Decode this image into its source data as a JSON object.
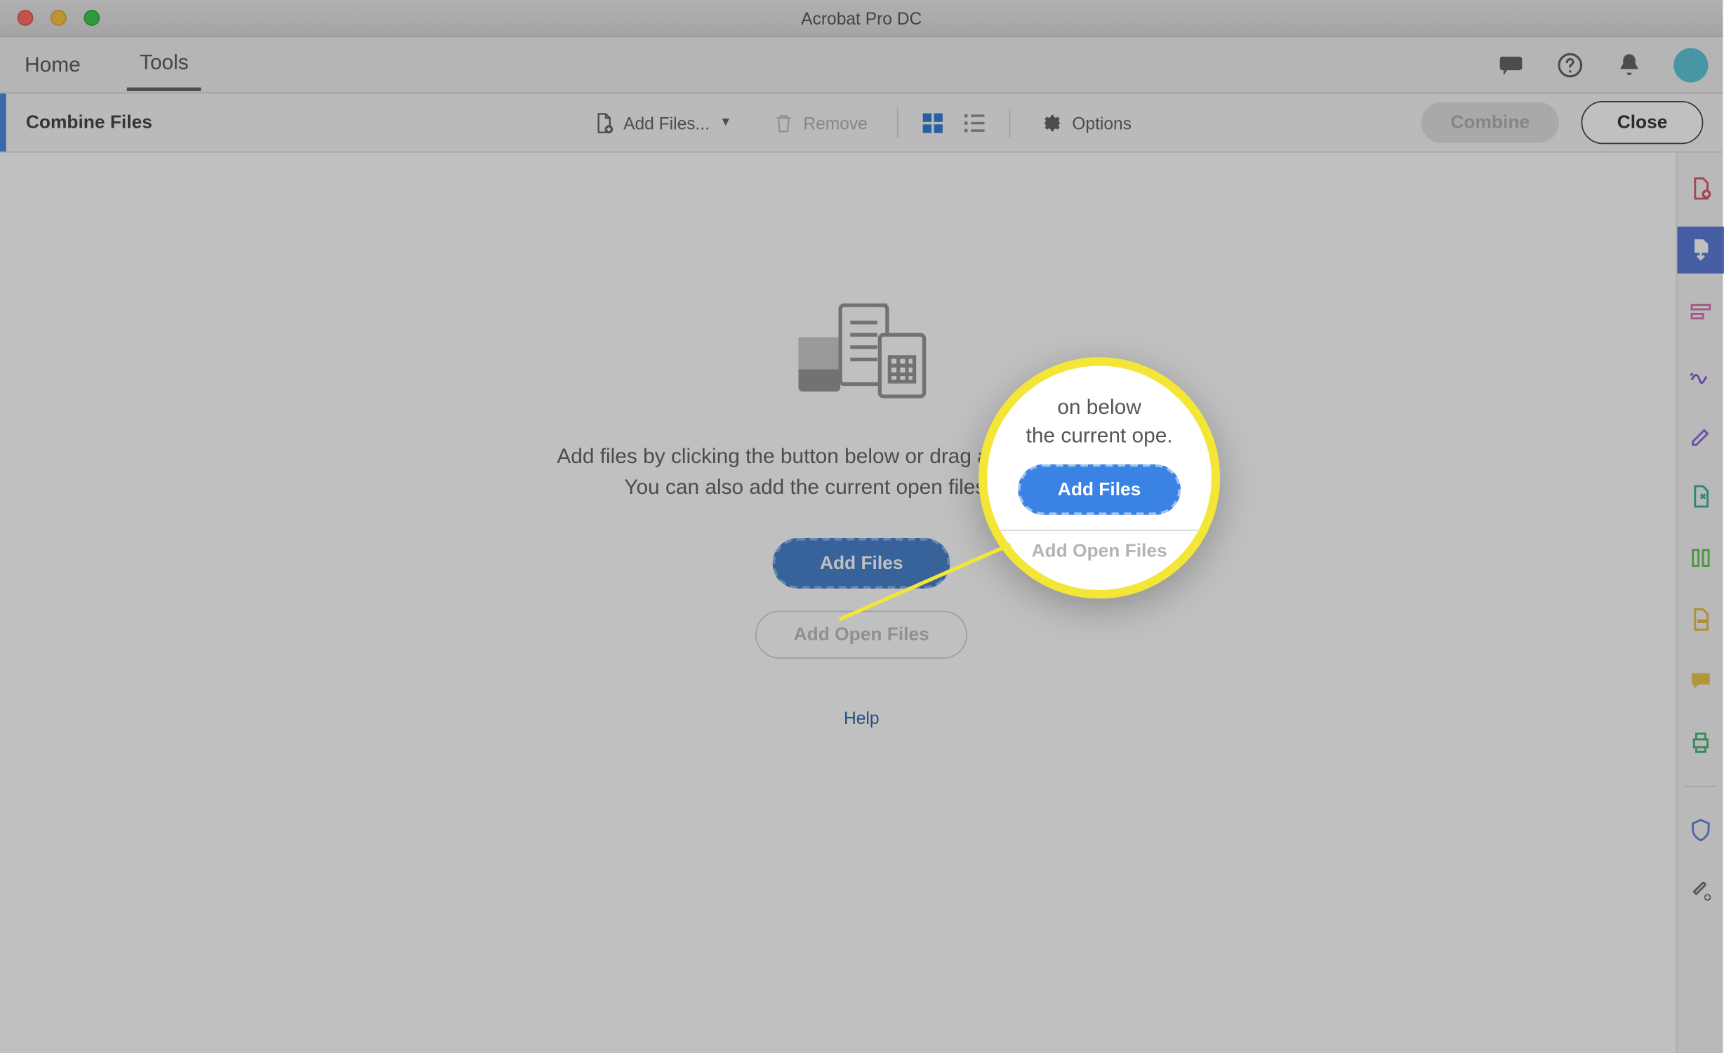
{
  "window": {
    "title": "Acrobat Pro DC"
  },
  "tabs": {
    "home": "Home",
    "tools": "Tools"
  },
  "toolbar": {
    "title": "Combine Files",
    "add_files": "Add Files...",
    "remove": "Remove",
    "options": "Options",
    "combine": "Combine",
    "close": "Close"
  },
  "center": {
    "line1": "Add files by clicking the button below or drag and drop them here.",
    "line2": "You can also add the current open files from below.",
    "add_files": "Add Files",
    "add_open": "Add Open Files",
    "help": "Help"
  },
  "spotlight": {
    "text_top": "on below\nthe current ope.",
    "add_files": "Add Files",
    "add_open": "Add Open Files"
  },
  "rail_items": [
    "create-pdf",
    "export-pdf",
    "edit-pdf",
    "sign",
    "fill-sign",
    "share",
    "organize",
    "comment",
    "print",
    "protect",
    "more-tools"
  ],
  "colors": {
    "accent": "#3a7fe0",
    "highlight": "#f4e637"
  }
}
